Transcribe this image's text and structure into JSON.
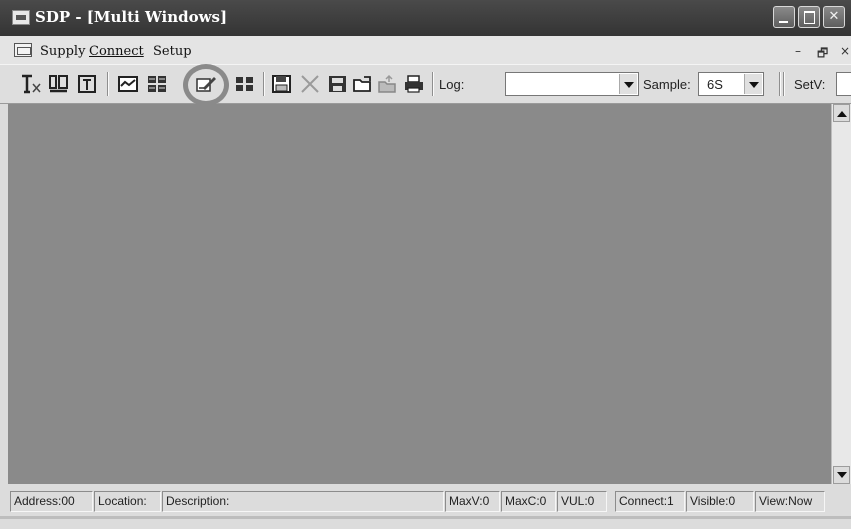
{
  "window": {
    "title": "SDP - [Multi Windows]",
    "buttons": {
      "minimize": "",
      "maximize": "",
      "close": "✕"
    }
  },
  "menubar": {
    "items": [
      "Supply",
      "Connect",
      "Setup"
    ],
    "mdi_minimize": "–",
    "mdi_restore": "🗗",
    "mdi_close": "×"
  },
  "toolbar": {
    "tools": [
      "text-x-icon",
      "memory-in-icon",
      "memory-out-icon",
      "chart-icon",
      "grid-icon",
      "edit-pencil-icon",
      "tiles-icon",
      "save-icon",
      "delete-icon",
      "save-as-icon",
      "open-folder-icon",
      "export-icon",
      "print-icon"
    ],
    "log_label": "Log:",
    "log_value": "",
    "sample_label": "Sample:",
    "sample_value": "6S",
    "setv_label": "SetV:",
    "highlight_color": "#8a8a8a"
  },
  "client": {
    "background": "#8a8a8a"
  },
  "statusbar": {
    "address": "Address:00",
    "location": "Location:",
    "description": "Description:",
    "maxv": "MaxV:0",
    "maxc": "MaxC:0",
    "vul": "VUL:0",
    "connect": "Connect:1",
    "visible": "Visible:0",
    "view": "View:Now"
  }
}
